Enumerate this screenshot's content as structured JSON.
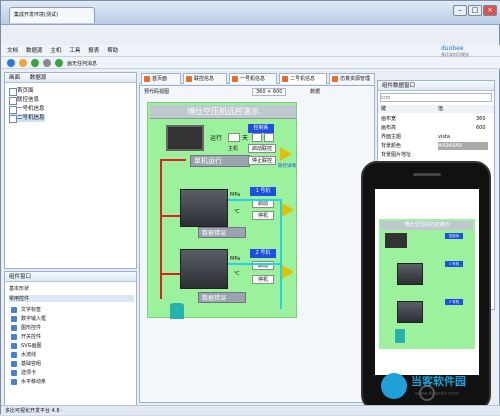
{
  "window": {
    "tab_title": "集成开发环境(测试)",
    "min": "–",
    "max": "□",
    "close": "×"
  },
  "menu": [
    "文档",
    "数据源",
    "主机",
    "工具",
    "报表",
    "帮助"
  ],
  "toolbar": {
    "monitor_label": "画无任何消息"
  },
  "brand": {
    "name": "duobee",
    "sub": "多比实时可视化"
  },
  "left_panel": {
    "tabs": [
      "画面",
      "数据源"
    ],
    "tree": [
      "首页面",
      "联控信息",
      "一号机信息",
      "二号机信息"
    ]
  },
  "doc_tabs": [
    "首页面",
    "联控信息",
    "一号机信息",
    "二号机信息",
    "仿真资源管理"
  ],
  "canvas_toolbar": {
    "preview": "预代码视图",
    "size": "360 × 600",
    "data": "数据"
  },
  "hmi": {
    "title": "博仕空压机远控演示",
    "control_badge": "控制系",
    "run_label": "运行",
    "days_unit": "天",
    "single_run": "单机运行",
    "main_label": "主机",
    "start_link": "启动联控",
    "stop_link": "停止联控",
    "link_detail": "联控详情",
    "machine1": "1 号机",
    "machine2": "2 号机",
    "start": "启动",
    "stop": "停机",
    "mpa": "MPa",
    "degc": "℃",
    "detail": "详情",
    "data_error": "数据错误"
  },
  "properties": {
    "title": "组件数据窗口",
    "search_placeholder": "ccm",
    "col_key": "键",
    "col_value": "值",
    "rows": [
      {
        "k": "画布宽",
        "v": "360"
      },
      {
        "k": "画布高",
        "v": "600"
      },
      {
        "k": "界面主题",
        "v": "vista"
      },
      {
        "k": "背景颜色",
        "v": "#A9A9A9"
      },
      {
        "k": "背景图片地址",
        "v": ""
      }
    ]
  },
  "left_dock": {
    "title": "组件窗口",
    "groups": [
      {
        "label": "基本形状"
      },
      {
        "label": "常用控件"
      }
    ],
    "items": [
      "文字标签",
      "数字输入框",
      "图形控件",
      "开关控件",
      "SVG画图",
      "水流线",
      "基础容组",
      "选项卡",
      "水平移动条"
    ]
  },
  "status": {
    "text": "多比可视化开发平台 4.8 ·"
  },
  "watermark": {
    "name": "当客软件园",
    "url": "www.downkr.com"
  },
  "colors": {
    "hmi_bg": "#9cf29c",
    "accent_blue": "#1d4fe0",
    "pipe_red": "#e02020",
    "pipe_cyan": "#27d0e6",
    "arrow_yellow": "#e0c000"
  }
}
